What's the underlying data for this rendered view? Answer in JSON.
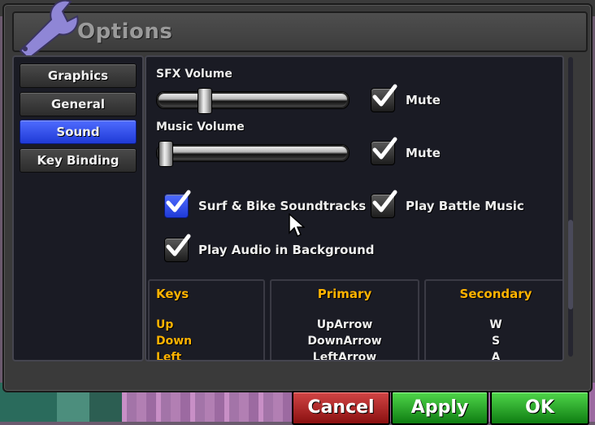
{
  "window": {
    "title": "Options"
  },
  "sidebar": {
    "tabs": [
      {
        "label": "Graphics",
        "active": false
      },
      {
        "label": "General",
        "active": false
      },
      {
        "label": "Sound",
        "active": true
      },
      {
        "label": "Key Binding",
        "active": false
      }
    ]
  },
  "sound": {
    "sfx_volume_label": "SFX Volume",
    "sfx_volume_level": 0.22,
    "sfx_mute_label": "Mute",
    "sfx_mute_checked": true,
    "music_volume_label": "Music Volume",
    "music_volume_level": 0.0,
    "music_mute_label": "Mute",
    "music_mute_checked": true,
    "options": [
      {
        "label": "Surf & Bike Soundtracks",
        "checked": true,
        "focused": true
      },
      {
        "label": "Play Battle Music",
        "checked": true,
        "focused": false
      },
      {
        "label": "Play Audio in Background",
        "checked": true,
        "focused": false
      }
    ]
  },
  "key_binding": {
    "headers": {
      "keys": "Keys",
      "primary": "Primary",
      "secondary": "Secondary"
    },
    "rows": [
      {
        "key": "Up",
        "primary": "UpArrow",
        "secondary": "W"
      },
      {
        "key": "Down",
        "primary": "DownArrow",
        "secondary": "S"
      },
      {
        "key": "Left",
        "primary": "LeftArrow",
        "secondary": "A"
      }
    ]
  },
  "buttons": {
    "cancel": "Cancel",
    "apply": "Apply",
    "ok": "OK"
  },
  "colors": {
    "accent_blue": "#2f4ef0",
    "key_orange": "#ffb300",
    "cancel_red": "#b22222",
    "confirm_green": "#1fa81f"
  },
  "icons": {
    "title": "wrench-icon",
    "check": "checkmark-icon",
    "cursor": "mouse-pointer-icon"
  }
}
